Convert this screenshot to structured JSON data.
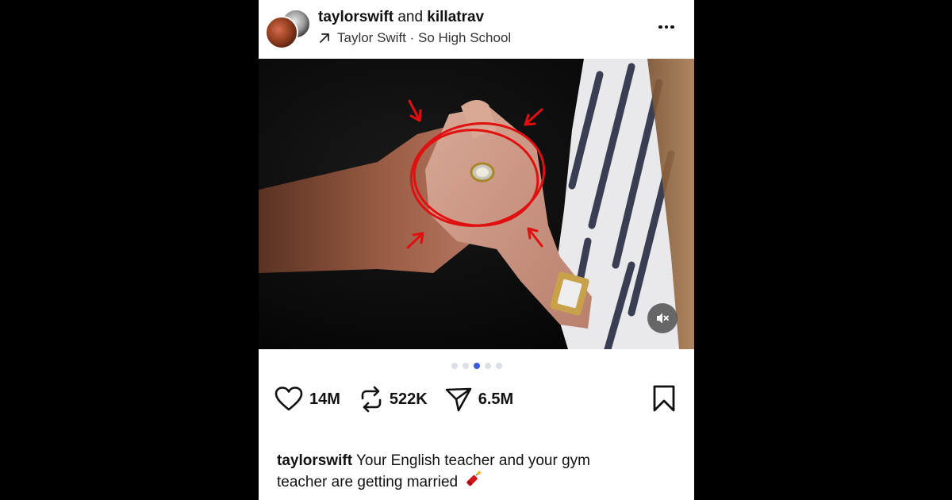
{
  "post": {
    "authors": {
      "primary": "taylorswift",
      "joiner": "and",
      "secondary": "killatrav"
    },
    "audio": {
      "icon": "arrow-up-right-icon",
      "label": "Taylor Swift · So High School"
    },
    "more_icon": "more-horizontal-icon",
    "media": {
      "description_icons": [
        "mute-icon"
      ],
      "carousel": {
        "count": 5,
        "active_index": 2
      }
    },
    "actions": {
      "likes": "14M",
      "reposts": "522K",
      "shares": "6.5M"
    },
    "caption": {
      "username": "taylorswift",
      "text": "Your English teacher and your gym teacher are getting married",
      "emoji": "firecracker"
    },
    "colors": {
      "accent_dot": "#3d5be0",
      "annotation_red": "#e01010",
      "background": "#000000"
    }
  }
}
